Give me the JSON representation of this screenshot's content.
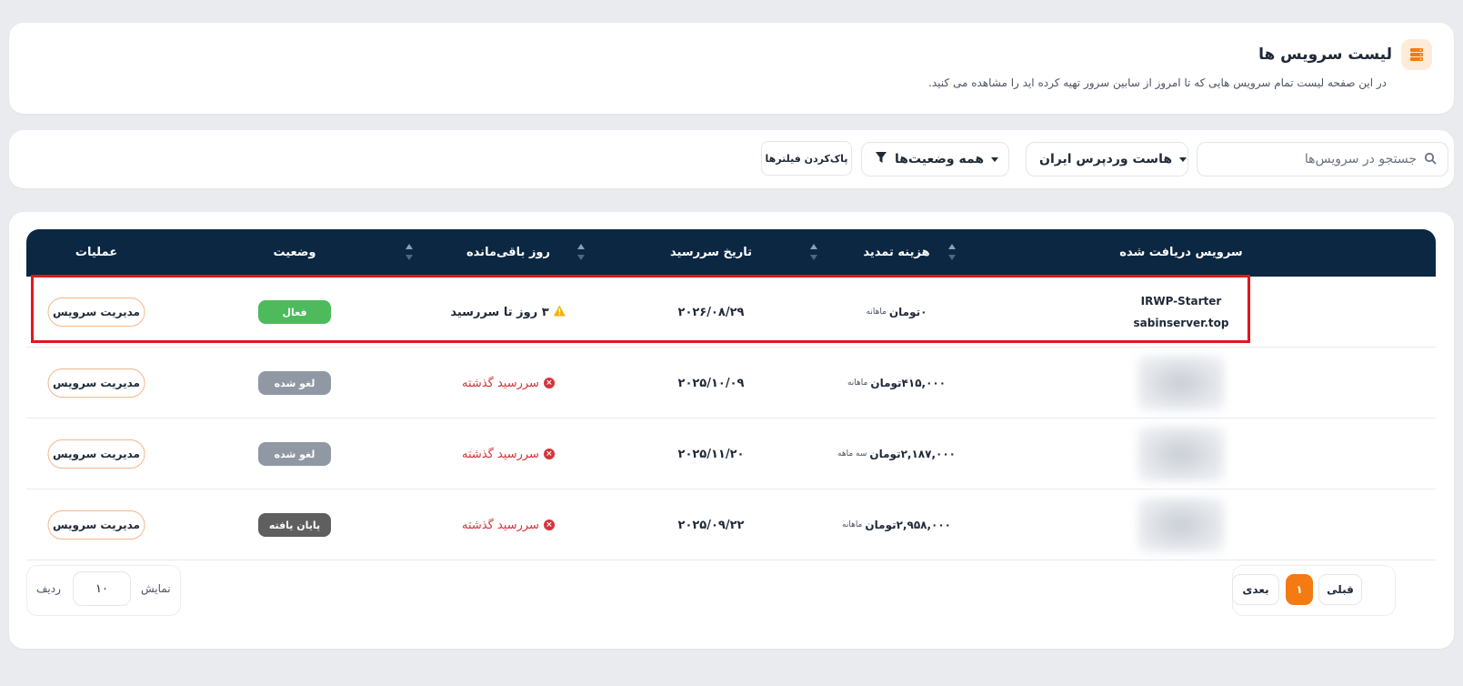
{
  "header": {
    "title": "لیست سرویس ها",
    "subtitle": "در این صفحه لیست تمام سرویس هایی که تا امروز از سابین سرور تهیه کرده اید را مشاهده می کنید.",
    "icon": "server-icon",
    "accent": "#f47a12"
  },
  "filters": {
    "search_placeholder": "جستجو در سرویس‌ها",
    "product_value": "هاست وردپرس ایران",
    "status_value": "همه وضعیت‌ها",
    "clear_label": "پاک‌کردن فیلترها"
  },
  "table": {
    "columns": {
      "service": "سرویس دریافت شده",
      "renewal": "هزینه تمدید",
      "due_date": "تاریخ سررسید",
      "days_left": "روز باقی‌مانده",
      "status": "وضعیت",
      "actions": "عملیات"
    },
    "rows": [
      {
        "service_name": "IRWP-Starter",
        "service_domain": "sabinserver.top",
        "price": "۰تومان",
        "period": "ماهانه",
        "due_date": "۲۰۲۶/۰۸/۲۹",
        "remaining": "۳ روز تا سررسید",
        "status": "فعال",
        "action": "مدیریت سرویس"
      },
      {
        "price": "۴۱۵,۰۰۰تومان",
        "period": "ماهانه",
        "due_date": "۲۰۲۵/۱۰/۰۹",
        "remaining": "سررسید گذشته",
        "status": "لغو شده",
        "action": "مدیریت سرویس"
      },
      {
        "price": "۲,۱۸۷,۰۰۰تومان",
        "period": "سه ماهه",
        "due_date": "۲۰۲۵/۱۱/۲۰",
        "remaining": "سررسید گذشته",
        "status": "لغو شده",
        "action": "مدیریت سرویس"
      },
      {
        "price": "۲,۹۵۸,۰۰۰تومان",
        "period": "ماهانه",
        "due_date": "۲۰۲۵/۰۹/۲۲",
        "remaining": "سررسید گذشته",
        "status": "پایان یافته",
        "action": "مدیریت سرویس"
      }
    ]
  },
  "footer": {
    "show_label": "نمایش",
    "rows_label": "ردیف",
    "page_size": "۱۰",
    "prev_label": "قبلی",
    "current_page": "۱",
    "next_label": "بعدی"
  },
  "colors": {
    "header_bg": "#0b2742",
    "active": "#4dbb5c",
    "cancelled": "#8f98a3",
    "ended": "#5f5f5f",
    "overdue": "#d6333c",
    "highlight": "#e3161b"
  }
}
